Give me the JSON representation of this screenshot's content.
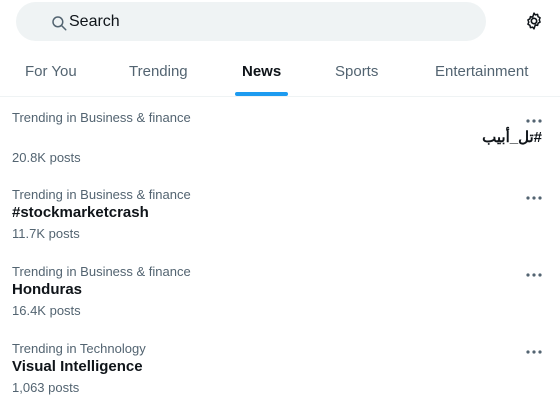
{
  "search": {
    "placeholder": "Search",
    "icon": "search-icon"
  },
  "settings": {
    "icon": "gear-icon"
  },
  "tabs": [
    {
      "label": "For You",
      "active": false
    },
    {
      "label": "Trending",
      "active": false
    },
    {
      "label": "News",
      "active": true
    },
    {
      "label": "Sports",
      "active": false
    },
    {
      "label": "Entertainment",
      "active": false
    }
  ],
  "trends": [
    {
      "context": "Trending in Business & finance",
      "name": "#تل_أبيب",
      "posts": "20.8K posts"
    },
    {
      "context": "Trending in Business & finance",
      "name": "#stockmarketcrash",
      "posts": "11.7K posts"
    },
    {
      "context": "Trending in Business & finance",
      "name": "Honduras",
      "posts": "16.4K posts"
    },
    {
      "context": "Trending in Technology",
      "name": "Visual Intelligence",
      "posts": "1,063 posts"
    }
  ],
  "colors": {
    "accent": "#1d9bf0",
    "search_bg": "#eff3f4",
    "secondary_text": "#536471",
    "primary_text": "#0f1419"
  }
}
